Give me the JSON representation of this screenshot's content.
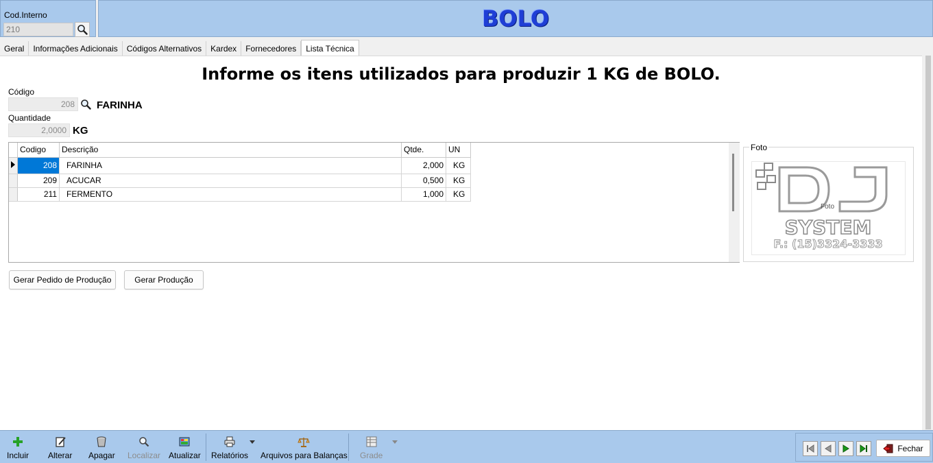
{
  "header": {
    "cod_label": "Cod.Interno",
    "cod_value": "210",
    "title": "BOLO"
  },
  "tabs": [
    {
      "label": "Geral"
    },
    {
      "label": "Informações Adicionais"
    },
    {
      "label": "Códigos Alternativos"
    },
    {
      "label": "Kardex"
    },
    {
      "label": "Fornecedores"
    },
    {
      "label": "Lista Técnica"
    }
  ],
  "form": {
    "heading": "Informe os itens utilizados para produzir 1 KG de BOLO.",
    "codigo_label": "Código",
    "codigo_value": "208",
    "codigo_desc": "FARINHA",
    "quantidade_label": "Quantidade",
    "quantidade_value": "2,0000",
    "quantidade_unit": "KG"
  },
  "grid": {
    "columns": [
      "Codigo",
      "Descrição",
      "Qtde.",
      "UN"
    ],
    "rows": [
      {
        "codigo": "208",
        "descricao": "FARINHA",
        "qtde": "2,000",
        "un": "KG"
      },
      {
        "codigo": "209",
        "descricao": "ACUCAR",
        "qtde": "0,500",
        "un": "KG"
      },
      {
        "codigo": "211",
        "descricao": "FERMENTO",
        "qtde": "1,000",
        "un": "KG"
      }
    ]
  },
  "foto": {
    "label": "Foto",
    "overlay_text": "Foto",
    "logo_line1": "DJ",
    "logo_line2": "SYSTEM",
    "logo_line3": "F.: (15)3324-3333"
  },
  "buttons": {
    "gerar_pedido": "Gerar Pedido de Produção",
    "gerar_producao": "Gerar Produção"
  },
  "toolbar": {
    "incluir": "Incluir",
    "alterar": "Alterar",
    "apagar": "Apagar",
    "localizar": "Localizar",
    "atualizar": "Atualizar",
    "relatorios": "Relatórios",
    "arquivos": "Arquivos para Balanças",
    "grade": "Grade",
    "fechar": "Fechar"
  },
  "icons": {
    "search": "search-icon",
    "incluir": "plus-icon",
    "alterar": "edit-icon",
    "apagar": "trash-icon",
    "localizar": "search-icon",
    "atualizar": "refresh-icon",
    "relatorios": "printer-icon",
    "arquivos": "scale-icon",
    "grade": "grid-icon",
    "fechar": "exit-icon"
  },
  "colors": {
    "header_bg": "#a9c9ec",
    "title": "#1f3fd6",
    "selection": "#0078d7",
    "nav_green": "#1a9a1a"
  }
}
